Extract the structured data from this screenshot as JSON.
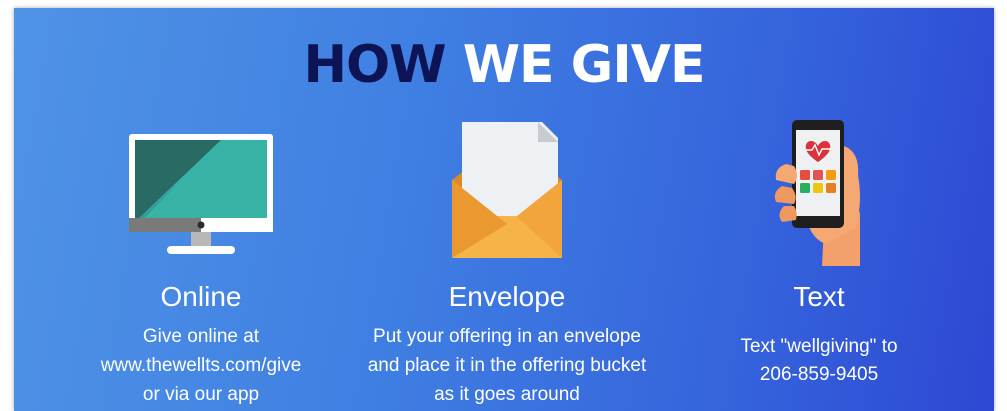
{
  "header": {
    "title_dark": "HOW",
    "title_light": "WE GIVE"
  },
  "methods": [
    {
      "title": "Online",
      "icon": "desktop-monitor-icon",
      "description": [
        "Give online at",
        "www.thewellts.com/give",
        "or via our app"
      ]
    },
    {
      "title": "Envelope",
      "icon": "envelope-letter-icon",
      "description": [
        "Put your offering in an envelope",
        "and place it in the offering bucket",
        "as it goes around"
      ]
    },
    {
      "title": "Text",
      "icon": "hand-smartphone-icon",
      "description": [
        "Text \"wellgiving\" to",
        "206-859-9405"
      ]
    }
  ],
  "colors": {
    "title_dark": "#0c1456",
    "gradient_start": "#4f93e6",
    "gradient_end": "#2d48d3",
    "envelope": "#f0a23c",
    "monitor_screen": "#2b6b66",
    "heart": "#d8323c"
  }
}
